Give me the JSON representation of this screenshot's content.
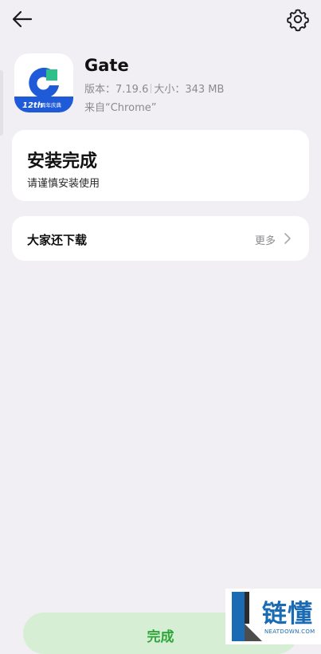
{
  "icons": {
    "back": "arrow-left-icon",
    "settings": "gear-icon",
    "chevron": "chevron-right-icon"
  },
  "colors": {
    "background": "#f1eff4",
    "card": "#ffffff",
    "accent_green": "#2fa53a",
    "done_button_bg": "#d6efd4",
    "muted_text": "#8b8a8f",
    "gate_blue": "#1f5bd8",
    "gate_green": "#2ec08a"
  },
  "app": {
    "name": "Gate",
    "version_label": "版本：7.19.6",
    "size_label": "大小：343 MB",
    "source_label": "来自“Chrome”",
    "badge_number": "12th",
    "badge_text": "周年庆典"
  },
  "install_card": {
    "title": "安装完成",
    "subtitle": "请谨慎安装使用"
  },
  "popular_card": {
    "title": "大家还下载",
    "more_label": "更多"
  },
  "footer": {
    "done_label": "完成"
  },
  "watermark": {
    "text": "链懂",
    "subtext": "NEATDOWN.COM"
  }
}
